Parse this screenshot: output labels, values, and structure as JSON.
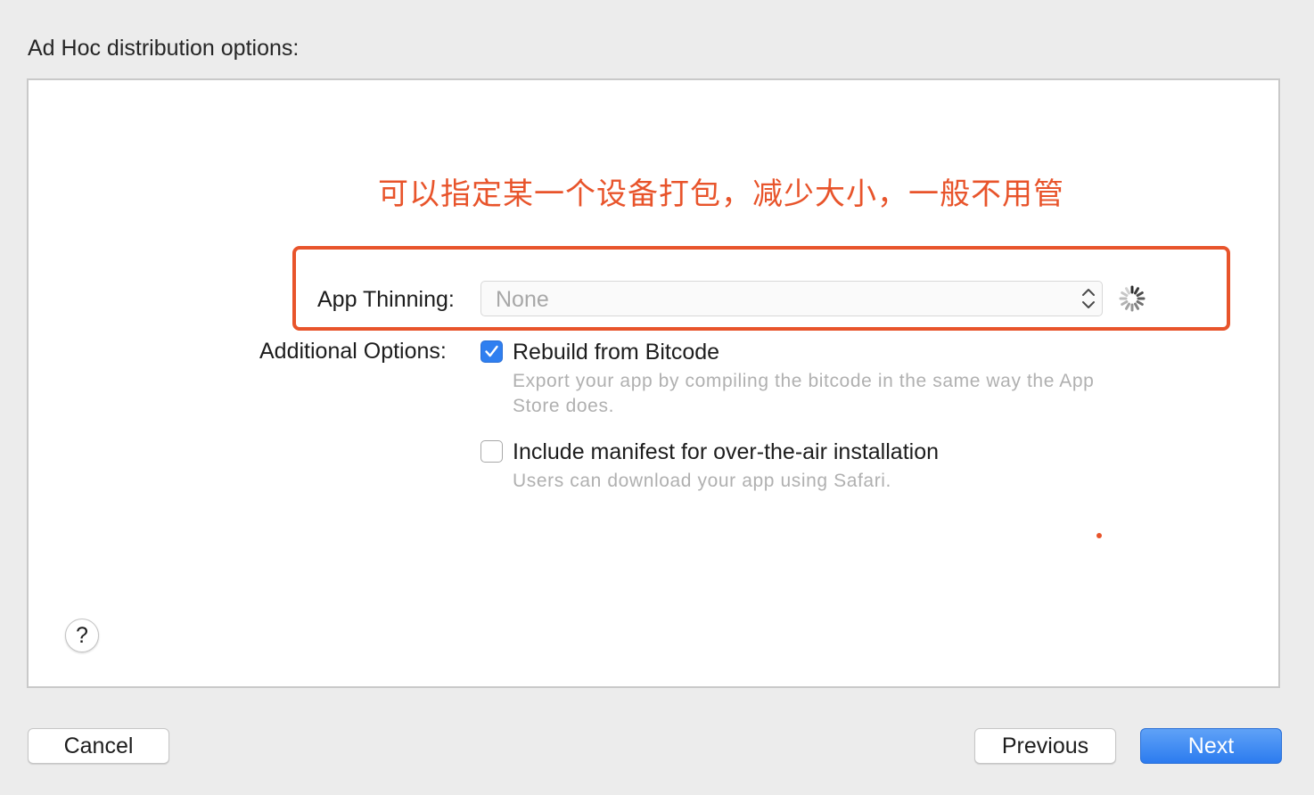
{
  "heading": "Ad Hoc distribution options:",
  "annotation": {
    "text": "可以指定某一个设备打包，减少大小，一般不用管",
    "color": "#e8542b"
  },
  "app_thinning": {
    "label": "App Thinning:",
    "value": "None",
    "loading": true
  },
  "additional_options": {
    "label": "Additional Options:",
    "options": [
      {
        "title": "Rebuild from Bitcode",
        "description": "Export your app by compiling the bitcode in the same way the App Store does.",
        "checked": true
      },
      {
        "title": "Include manifest for over-the-air installation",
        "description": "Users can download your app using Safari.",
        "checked": false
      }
    ]
  },
  "help_label": "?",
  "buttons": {
    "cancel": "Cancel",
    "previous": "Previous",
    "next": "Next"
  },
  "colors": {
    "accent": "#2f7ff0",
    "annotation": "#e8542b"
  },
  "icons": {
    "checkbox_checked": "checkmark-icon",
    "select_arrows": "up-down-chevron-icon",
    "spinner": "loading-spinner-icon"
  }
}
